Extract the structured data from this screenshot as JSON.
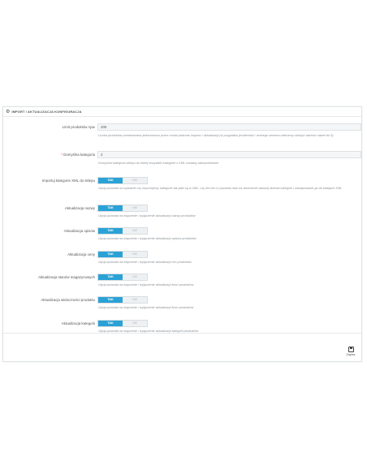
{
  "panel": {
    "title": "IMPORT / AKTUALIZACJA KONFIGURACJA",
    "cog_icon": "cog-icon"
  },
  "fields": {
    "limit": {
      "label": "Limit produktów Ajax",
      "value": "200",
      "help": "Liczba produktów przetwarzana jednorazowo przez moduł podczas importu / aktualizacji (w przypadku problemów / wolnego serwera zalecamy obniżyć wartość nawet do 5)"
    },
    "default_category": {
      "required_mark": "*",
      "label": "Domyślna kategoria",
      "value": "2",
      "help": "Domyślna kategoria sklepu do której wszystkie kategorie z XML zostaną zaimportowane"
    }
  },
  "toggles": {
    "import_categories": {
      "label": "Importuj kategorie XML do sklepu",
      "yes": "TAK",
      "no": "NIE",
      "help": "Opcja pozwala na wybranie czy importujemy kategorie tak jake są w XML, czy też nie co pozwala nam na stworzenie własnej drzewa kategorii i zamapowanie go do kategorii XML"
    },
    "update_name": {
      "label": "Aktualizacja nazwy",
      "yes": "TAK",
      "no": "NIE",
      "help": "Opcja pozwala na włączenie / wyłączenie aktualizacji nazwy produktów"
    },
    "update_description": {
      "label": "Aktualizacja opisów",
      "yes": "TAK",
      "no": "NIE",
      "help": "Opcja pozwala na włączenie / wyłączenie aktualizacji opisów produktów"
    },
    "update_price": {
      "label": "Aktualizacja ceny",
      "yes": "TAK",
      "no": "NIE",
      "help": "Opcja pozwala na włączenie / wyłączenie aktualizacji cen produktów"
    },
    "update_stock": {
      "label": "Aktualizacja stanów magazynowych",
      "yes": "TAK",
      "no": "NIE",
      "help": "Opcja pozwala na włączenie / wyłączenie aktualizacji ilości produktów"
    },
    "update_visibility": {
      "label": "Aktualizacja widoczności produktu",
      "yes": "TAK",
      "no": "NIE",
      "help": "Opcja pozwala na włączenie / wyłączenie aktualizacji ilości produktów"
    },
    "update_categories": {
      "label": "Aktualizacja kategorii",
      "yes": "TAK",
      "no": "NIE",
      "help": "Opcja pozwala na włączenie / wyłączenie aktualizacji kategorii produktów"
    }
  },
  "footer": {
    "save_label": "Zapisz",
    "save_icon": "save-icon"
  },
  "colors": {
    "toggle_on": "#2ba2d6",
    "required": "#e63946"
  }
}
